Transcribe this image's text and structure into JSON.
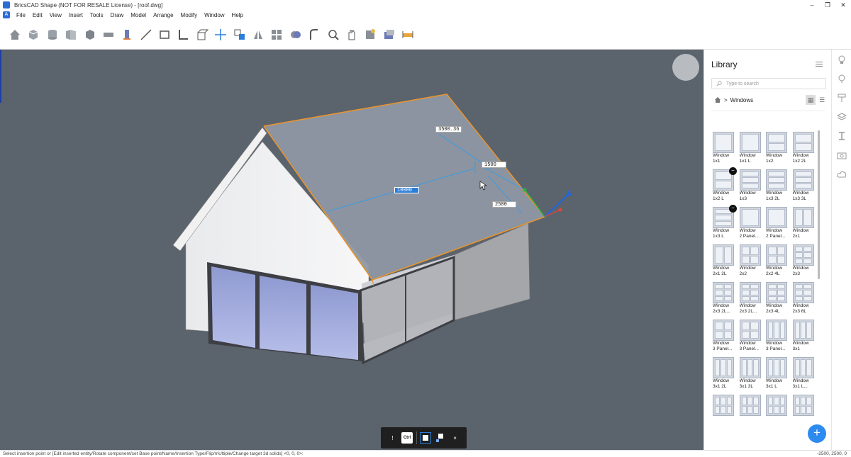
{
  "window": {
    "title": "BricsCAD Shape (NOT FOR RESALE License) - [roof.dwg]",
    "controls": [
      "–",
      "❐",
      "✕"
    ]
  },
  "menu": [
    "File",
    "Edit",
    "View",
    "Insert",
    "Tools",
    "Draw",
    "Model",
    "Arrange",
    "Modify",
    "Window",
    "Help"
  ],
  "toolbar": [
    "home",
    "box",
    "cylinder",
    "wall",
    "solid",
    "slab",
    "column",
    "line",
    "rectangle",
    "polyline",
    "extrude",
    "move",
    "copy",
    "mirror",
    "array",
    "union",
    "round",
    "zoom",
    "pan",
    "render",
    "materials",
    "measure"
  ],
  "viewport": {
    "dimensions": {
      "top": "3500.36",
      "right_upper": "1500",
      "active": "10000",
      "right_lower": "2500"
    }
  },
  "quickbar": {
    "items": [
      "info",
      "Ctrl",
      "solid-square",
      "multi-square",
      "close"
    ],
    "ctrl_label": "Ctrl",
    "close": "×",
    "info": "!"
  },
  "library": {
    "title": "Library",
    "search_placeholder": "Type to search",
    "breadcrumb_sep": ">",
    "breadcrumb": "Windows",
    "items": [
      {
        "l1": "Window",
        "l2": "1x1",
        "c": 1,
        "r": 1
      },
      {
        "l1": "Window",
        "l2": "1x1 L",
        "c": 1,
        "r": 1
      },
      {
        "l1": "Window",
        "l2": "1x2",
        "c": 1,
        "r": 2
      },
      {
        "l1": "Window",
        "l2": "1x2 2L",
        "c": 1,
        "r": 2
      },
      {
        "l1": "Window",
        "l2": "1x2 L",
        "c": 1,
        "r": 2,
        "badge": true
      },
      {
        "l1": "Window",
        "l2": "1x3",
        "c": 1,
        "r": 3
      },
      {
        "l1": "Window",
        "l2": "1x3 2L",
        "c": 1,
        "r": 3
      },
      {
        "l1": "Window",
        "l2": "1x3 3L",
        "c": 1,
        "r": 3
      },
      {
        "l1": "Window",
        "l2": "1x3 L",
        "c": 1,
        "r": 3,
        "badge": true
      },
      {
        "l1": "Window",
        "l2": "2 Panel...",
        "c": 1,
        "r": 1
      },
      {
        "l1": "Window",
        "l2": "2 Panel...",
        "c": 1,
        "r": 1
      },
      {
        "l1": "Window",
        "l2": "2x1",
        "c": 2,
        "r": 1
      },
      {
        "l1": "Window",
        "l2": "2x1 2L",
        "c": 2,
        "r": 1
      },
      {
        "l1": "Window",
        "l2": "2x2",
        "c": 2,
        "r": 2
      },
      {
        "l1": "Window",
        "l2": "2x2 4L",
        "c": 2,
        "r": 2
      },
      {
        "l1": "Window",
        "l2": "2x3",
        "c": 2,
        "r": 3
      },
      {
        "l1": "Window",
        "l2": "2x3 2L...",
        "c": 2,
        "r": 3
      },
      {
        "l1": "Window",
        "l2": "2x3 2L...",
        "c": 2,
        "r": 3
      },
      {
        "l1": "Window",
        "l2": "2x3 4L",
        "c": 2,
        "r": 3
      },
      {
        "l1": "Window",
        "l2": "2x3 6L",
        "c": 2,
        "r": 3
      },
      {
        "l1": "Window",
        "l2": "3 Panel...",
        "c": 2,
        "r": 2
      },
      {
        "l1": "Window",
        "l2": "3 Panel...",
        "c": 2,
        "r": 2
      },
      {
        "l1": "Window",
        "l2": "3 Panel...",
        "c": 3,
        "r": 1
      },
      {
        "l1": "Window",
        "l2": "3x1",
        "c": 3,
        "r": 1
      },
      {
        "l1": "Window",
        "l2": "3x1 2L",
        "c": 3,
        "r": 1
      },
      {
        "l1": "Window",
        "l2": "3x1 3L",
        "c": 3,
        "r": 1
      },
      {
        "l1": "Window",
        "l2": "3x1 L",
        "c": 3,
        "r": 1
      },
      {
        "l1": "Window",
        "l2": "3x1 L...",
        "c": 3,
        "r": 1
      },
      {
        "l1": "",
        "l2": "",
        "c": 3,
        "r": 2
      },
      {
        "l1": "",
        "l2": "",
        "c": 3,
        "r": 2
      },
      {
        "l1": "",
        "l2": "",
        "c": 3,
        "r": 2
      },
      {
        "l1": "",
        "l2": "",
        "c": 3,
        "r": 2
      }
    ],
    "add_label": "+"
  },
  "rightrail": [
    "lightbulb",
    "bulb-outline",
    "paint-roller",
    "layers",
    "i-beam",
    "camera",
    "cloud"
  ],
  "status": {
    "prompt": "Select insertion point or [Edit inserted entity/Rotate component/set Base point/Name/Insertion Type/Flip/mUltiple/Change target 3d solids] <0, 0, 0>:",
    "coords": "-2500, 2500, 0"
  },
  "colors": {
    "viewport_bg": "#5b636d",
    "accent": "#2a7ed9",
    "roof_edge": "#e8942f"
  }
}
